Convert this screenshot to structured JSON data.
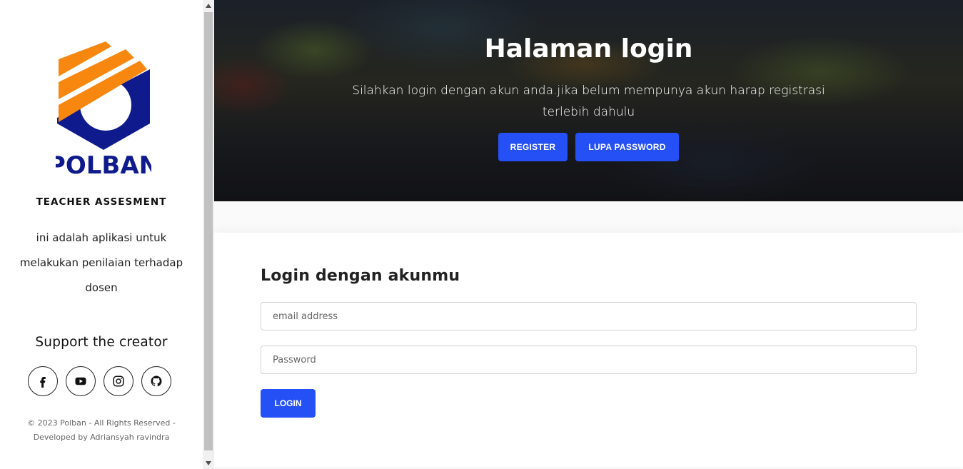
{
  "sidebar": {
    "logo_text": "POLBAN",
    "app_name": "TEACHER ASSESMENT",
    "description": "ini adalah aplikasi untuk melakukan penilaian terhadap dosen",
    "support_title": "Support the creator",
    "social": [
      {
        "icon": "facebook-icon"
      },
      {
        "icon": "youtube-icon"
      },
      {
        "icon": "instagram-icon"
      },
      {
        "icon": "github-icon"
      }
    ],
    "copyright": "© 2023 Polban - All Rights Reserved - Developed by Adriansyah ravindra"
  },
  "hero": {
    "title": "Halaman login",
    "subtitle": "Silahkan login dengan akun anda.jika belum mempunya akun harap registrasi terlebih dahulu",
    "register_label": "REGISTER",
    "forgot_label": "LUPA PASSWORD"
  },
  "login": {
    "title": "Login dengan akunmu",
    "email_placeholder": "email address",
    "password_placeholder": "Password",
    "button_label": "LOGIN"
  },
  "colors": {
    "accent": "#2550f5",
    "logo_orange": "#f7870f",
    "logo_navy": "#0f1b8c"
  }
}
